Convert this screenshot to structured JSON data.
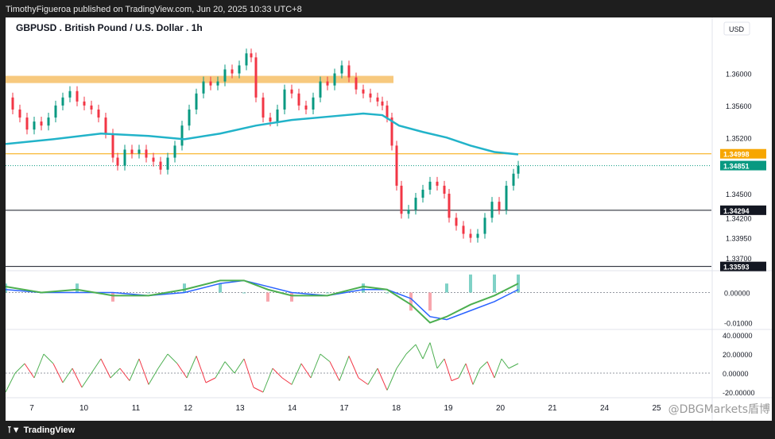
{
  "header": {
    "published_text": "TimothyFigueroa published on TradingView.com, Jun 20, 2025 10:33 UTC+8"
  },
  "footer": {
    "logo_text": "TradingView",
    "watermark": "@DBGMarkets盾博"
  },
  "chart_data": {
    "type": "line",
    "title": "GBPUSD . British Pound / U.S. Dollar . 1h",
    "currency": "USD",
    "x_ticks": [
      "7",
      "10",
      "11",
      "12",
      "13",
      "14",
      "17",
      "18",
      "19",
      "20",
      "21",
      "24",
      "25"
    ],
    "price_axis": {
      "ylim": [
        1.3355,
        1.365
      ],
      "tick_labels": [
        "1.36000",
        "1.35600",
        "1.35200",
        "1.34500",
        "1.34200",
        "1.33950",
        "1.33700"
      ],
      "tick_values": [
        1.36,
        1.356,
        1.352,
        1.345,
        1.342,
        1.3395,
        1.337
      ]
    },
    "price_markers": [
      {
        "label": "1.34998",
        "value": 1.34998,
        "color": "#f7a600"
      },
      {
        "label": "1.34851",
        "value": 1.34851,
        "color": "#089981"
      },
      {
        "label": "1.34294",
        "value": 1.34294,
        "color": "#131722"
      },
      {
        "label": "1.33593",
        "value": 1.33593,
        "color": "#131722"
      }
    ],
    "resistance_zone": [
      1.3588,
      1.3597
    ],
    "horizontal_lines": [
      1.34998,
      1.34294,
      1.33593
    ],
    "price_series": [
      [
        0,
        1.357
      ],
      [
        3,
        1.3555
      ],
      [
        6,
        1.3545
      ],
      [
        9,
        1.353
      ],
      [
        12,
        1.354
      ],
      [
        15,
        1.3535
      ],
      [
        18,
        1.3545
      ],
      [
        21,
        1.356
      ],
      [
        24,
        1.357
      ],
      [
        27,
        1.3578
      ],
      [
        30,
        1.3565
      ],
      [
        33,
        1.356
      ],
      [
        36,
        1.3555
      ],
      [
        39,
        1.3545
      ],
      [
        42,
        1.3525
      ],
      [
        45,
        1.3495
      ],
      [
        47,
        1.3485
      ],
      [
        50,
        1.3505
      ],
      [
        53,
        1.35
      ],
      [
        56,
        1.3505
      ],
      [
        59,
        1.3495
      ],
      [
        62,
        1.349
      ],
      [
        65,
        1.348
      ],
      [
        68,
        1.3495
      ],
      [
        71,
        1.351
      ],
      [
        74,
        1.3535
      ],
      [
        77,
        1.3555
      ],
      [
        80,
        1.3575
      ],
      [
        83,
        1.359
      ],
      [
        86,
        1.3585
      ],
      [
        89,
        1.359
      ],
      [
        92,
        1.3605
      ],
      [
        95,
        1.36
      ],
      [
        98,
        1.361
      ],
      [
        101,
        1.3625
      ],
      [
        103,
        1.362
      ],
      [
        105,
        1.357
      ],
      [
        108,
        1.3545
      ],
      [
        111,
        1.354
      ],
      [
        114,
        1.3555
      ],
      [
        117,
        1.358
      ],
      [
        120,
        1.3575
      ],
      [
        123,
        1.356
      ],
      [
        126,
        1.3555
      ],
      [
        129,
        1.357
      ],
      [
        132,
        1.359
      ],
      [
        135,
        1.3585
      ],
      [
        138,
        1.36
      ],
      [
        141,
        1.361
      ],
      [
        144,
        1.3595
      ],
      [
        147,
        1.358
      ],
      [
        150,
        1.3575
      ],
      [
        153,
        1.357
      ],
      [
        156,
        1.3565
      ],
      [
        158,
        1.356
      ],
      [
        160,
        1.3545
      ],
      [
        162,
        1.351
      ],
      [
        164,
        1.346
      ],
      [
        166,
        1.3425
      ],
      [
        169,
        1.343
      ],
      [
        172,
        1.3445
      ],
      [
        175,
        1.3455
      ],
      [
        178,
        1.3465
      ],
      [
        181,
        1.346
      ],
      [
        184,
        1.345
      ],
      [
        186,
        1.342
      ],
      [
        189,
        1.341
      ],
      [
        192,
        1.34
      ],
      [
        195,
        1.3395
      ],
      [
        198,
        1.34
      ],
      [
        201,
        1.342
      ],
      [
        204,
        1.344
      ],
      [
        207,
        1.343
      ],
      [
        210,
        1.346
      ],
      [
        213,
        1.3475
      ],
      [
        215,
        1.3485
      ]
    ],
    "ma_series": [
      [
        0,
        1.3512
      ],
      [
        20,
        1.3518
      ],
      [
        40,
        1.3525
      ],
      [
        60,
        1.3522
      ],
      [
        75,
        1.3518
      ],
      [
        90,
        1.3525
      ],
      [
        105,
        1.3535
      ],
      [
        120,
        1.3542
      ],
      [
        135,
        1.3546
      ],
      [
        150,
        1.355
      ],
      [
        158,
        1.3548
      ],
      [
        165,
        1.3535
      ],
      [
        175,
        1.3527
      ],
      [
        185,
        1.352
      ],
      [
        195,
        1.351
      ],
      [
        205,
        1.3502
      ],
      [
        215,
        1.3499
      ]
    ],
    "macd_axis": {
      "ylim": [
        -0.0012,
        0.0007
      ],
      "tick_labels": [
        "0.00000",
        "-0.01000"
      ],
      "tick_values": [
        0.0,
        -0.001
      ]
    },
    "macd_series": [
      [
        0,
        0.0002
      ],
      [
        15,
        0.0
      ],
      [
        30,
        0.0001
      ],
      [
        45,
        -0.0001
      ],
      [
        60,
        -0.0001
      ],
      [
        75,
        0.0001
      ],
      [
        90,
        0.0004
      ],
      [
        100,
        0.0004
      ],
      [
        110,
        0.0001
      ],
      [
        120,
        -0.0001
      ],
      [
        135,
        -0.0001
      ],
      [
        150,
        0.0002
      ],
      [
        160,
        0.0001
      ],
      [
        170,
        -0.0004
      ],
      [
        178,
        -0.001
      ],
      [
        185,
        -0.0008
      ],
      [
        195,
        -0.0004
      ],
      [
        205,
        -0.0001
      ],
      [
        215,
        0.0003
      ]
    ],
    "signal_series": [
      [
        0,
        0.0001
      ],
      [
        15,
        0.0
      ],
      [
        30,
        0.0
      ],
      [
        45,
        0.0
      ],
      [
        60,
        -0.0001
      ],
      [
        75,
        0.0
      ],
      [
        90,
        0.0003
      ],
      [
        100,
        0.0004
      ],
      [
        110,
        0.0002
      ],
      [
        120,
        0.0
      ],
      [
        135,
        -0.0001
      ],
      [
        150,
        0.0001
      ],
      [
        160,
        0.0001
      ],
      [
        170,
        -0.0002
      ],
      [
        178,
        -0.0008
      ],
      [
        185,
        -0.0009
      ],
      [
        195,
        -0.0006
      ],
      [
        205,
        -0.0003
      ],
      [
        215,
        0.0001
      ]
    ],
    "rsi_axis": {
      "ylim": [
        -25,
        45
      ],
      "tick_labels": [
        "40.00000",
        "20.00000",
        "0.00000",
        "-20.00000"
      ],
      "tick_values": [
        40,
        20,
        0,
        -20
      ]
    },
    "rsi_series": [
      [
        0,
        -20
      ],
      [
        4,
        0
      ],
      [
        8,
        10
      ],
      [
        12,
        -5
      ],
      [
        16,
        20
      ],
      [
        20,
        10
      ],
      [
        24,
        -10
      ],
      [
        28,
        5
      ],
      [
        32,
        -15
      ],
      [
        36,
        0
      ],
      [
        40,
        15
      ],
      [
        44,
        -5
      ],
      [
        48,
        5
      ],
      [
        52,
        -8
      ],
      [
        56,
        15
      ],
      [
        60,
        -12
      ],
      [
        64,
        5
      ],
      [
        68,
        20
      ],
      [
        72,
        10
      ],
      [
        76,
        -5
      ],
      [
        80,
        18
      ],
      [
        84,
        -10
      ],
      [
        88,
        -5
      ],
      [
        92,
        12
      ],
      [
        96,
        0
      ],
      [
        100,
        15
      ],
      [
        104,
        -15
      ],
      [
        108,
        -20
      ],
      [
        112,
        5
      ],
      [
        116,
        -5
      ],
      [
        120,
        -12
      ],
      [
        124,
        10
      ],
      [
        128,
        -5
      ],
      [
        132,
        20
      ],
      [
        136,
        12
      ],
      [
        140,
        -8
      ],
      [
        144,
        18
      ],
      [
        148,
        -5
      ],
      [
        152,
        -12
      ],
      [
        156,
        5
      ],
      [
        160,
        -18
      ],
      [
        164,
        5
      ],
      [
        168,
        20
      ],
      [
        172,
        30
      ],
      [
        175,
        15
      ],
      [
        178,
        32
      ],
      [
        181,
        5
      ],
      [
        184,
        15
      ],
      [
        187,
        -8
      ],
      [
        190,
        -5
      ],
      [
        193,
        10
      ],
      [
        196,
        -12
      ],
      [
        199,
        5
      ],
      [
        202,
        12
      ],
      [
        205,
        -5
      ],
      [
        208,
        15
      ],
      [
        211,
        5
      ],
      [
        215,
        10
      ]
    ]
  }
}
